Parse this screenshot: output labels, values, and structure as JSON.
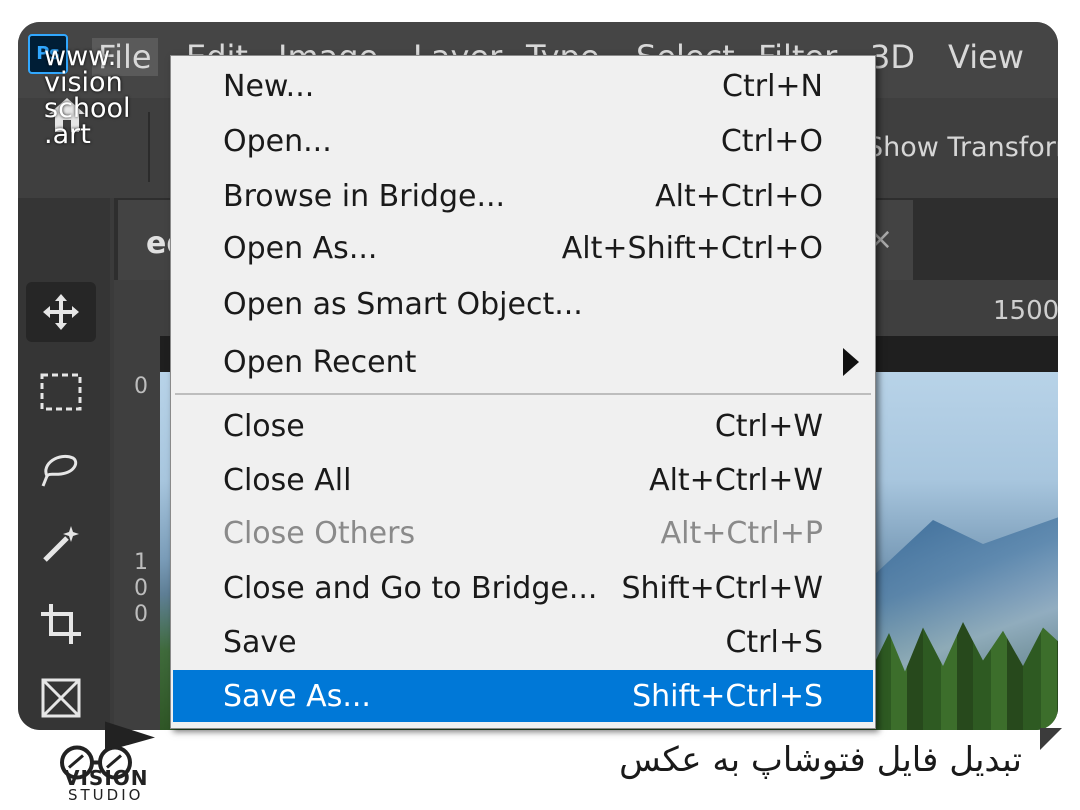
{
  "app": {
    "logo_text": "Ps"
  },
  "menubar": {
    "items": [
      {
        "label": "File",
        "active": true
      },
      {
        "label": "Edit"
      },
      {
        "label": "Image"
      },
      {
        "label": "Layer"
      },
      {
        "label": "Type"
      },
      {
        "label": "Select"
      },
      {
        "label": "Filter"
      },
      {
        "label": "3D"
      },
      {
        "label": "View"
      }
    ]
  },
  "options_bar": {
    "transform_controls_label": "Show Transform Controls"
  },
  "document_tab": {
    "label": "ed",
    "close_glyph": "×"
  },
  "rulers": {
    "top_label": "1500",
    "left_labels": [
      "0",
      "1",
      "0",
      "0"
    ]
  },
  "file_menu": {
    "items": [
      {
        "label": "New...",
        "shortcut": "Ctrl+N"
      },
      {
        "label": "Open...",
        "shortcut": "Ctrl+O"
      },
      {
        "label": "Browse in Bridge...",
        "shortcut": "Alt+Ctrl+O"
      },
      {
        "label": "Open As...",
        "shortcut": "Alt+Shift+Ctrl+O"
      },
      {
        "label": "Open as Smart Object...",
        "shortcut": ""
      },
      {
        "label": "Open Recent",
        "shortcut": "",
        "submenu": true
      },
      {
        "label": "Close",
        "shortcut": "Ctrl+W"
      },
      {
        "label": "Close All",
        "shortcut": "Alt+Ctrl+W"
      },
      {
        "label": "Close Others",
        "shortcut": "Alt+Ctrl+P",
        "disabled": true
      },
      {
        "label": "Close and Go to Bridge...",
        "shortcut": "Shift+Ctrl+W"
      },
      {
        "label": "Save",
        "shortcut": "Ctrl+S"
      },
      {
        "label": "Save As...",
        "shortcut": "Shift+Ctrl+S",
        "highlighted": true
      }
    ]
  },
  "watermark": {
    "text": "www.\nvision\nschool\n.art"
  },
  "branding": {
    "studio_name": "VISION",
    "studio_sub": "STUDIO"
  },
  "caption": {
    "text": "تبدیل فایل فتوشاپ به عکس"
  },
  "colors": {
    "highlight": "#0078d7",
    "menu_bg": "#f0f0f0",
    "ps_blue": "#31a8ff"
  }
}
